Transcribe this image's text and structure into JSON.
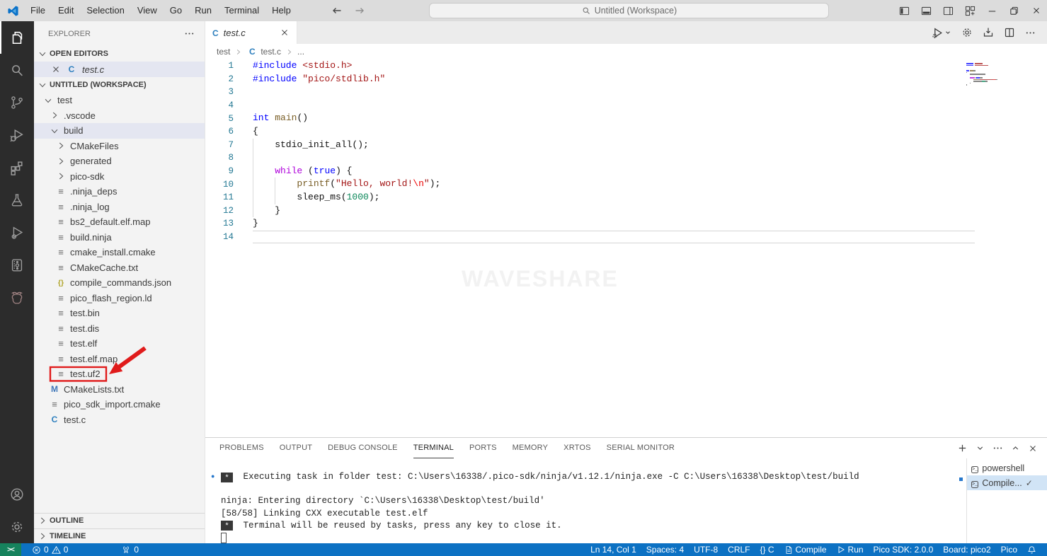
{
  "title_bar": {
    "menus": [
      "File",
      "Edit",
      "Selection",
      "View",
      "Go",
      "Run",
      "Terminal",
      "Help"
    ],
    "search_label": "Untitled (Workspace)",
    "window_controls": [
      {
        "name": "toggle-primary-sidebar-button",
        "icon": "layout-sidebar-left-icon"
      },
      {
        "name": "toggle-panel-button",
        "icon": "layout-panel-icon"
      },
      {
        "name": "toggle-secondary-sidebar-button",
        "icon": "layout-sidebar-right-icon"
      },
      {
        "name": "customize-layout-button",
        "icon": "layout-grid-icon"
      },
      {
        "name": "minimize-button",
        "icon": "minimize-icon"
      },
      {
        "name": "restore-button",
        "icon": "restore-icon"
      },
      {
        "name": "close-button",
        "icon": "close-icon"
      }
    ]
  },
  "activity_bar": {
    "top": [
      {
        "name": "explorer",
        "icon": "files-icon",
        "active": true
      },
      {
        "name": "search",
        "icon": "search-icon"
      },
      {
        "name": "source-control",
        "icon": "source-control-icon"
      },
      {
        "name": "run-and-debug",
        "icon": "run-debug-icon"
      },
      {
        "name": "extensions",
        "icon": "extensions-icon"
      },
      {
        "name": "testing",
        "icon": "testing-icon"
      },
      {
        "name": "cmake",
        "icon": "cmake-icon"
      },
      {
        "name": "pico-board",
        "icon": "board-icon"
      },
      {
        "name": "raspberry-pi-pico",
        "icon": "raspberry-icon",
        "color": "#9d8080"
      }
    ],
    "bottom": [
      {
        "name": "accounts",
        "icon": "account-icon"
      },
      {
        "name": "settings",
        "icon": "settings-gear-icon"
      }
    ]
  },
  "sidebar": {
    "title": "EXPLORER",
    "open_editors_label": "OPEN EDITORS",
    "open_editors": [
      {
        "label": "test.c",
        "icon": "c-file-icon",
        "selected": true
      }
    ],
    "workspace_label": "UNTITLED (WORKSPACE)",
    "tree": [
      {
        "label": "test",
        "level": 1,
        "kind": "folder",
        "expanded": true
      },
      {
        "label": ".vscode",
        "level": 2,
        "kind": "folder",
        "expanded": false
      },
      {
        "label": "build",
        "level": 2,
        "kind": "folder",
        "expanded": true,
        "focused": true
      },
      {
        "label": "CMakeFiles",
        "level": 3,
        "kind": "folder",
        "expanded": false
      },
      {
        "label": "generated",
        "level": 3,
        "kind": "folder",
        "expanded": false
      },
      {
        "label": "pico-sdk",
        "level": 3,
        "kind": "folder",
        "expanded": false
      },
      {
        "label": ".ninja_deps",
        "level": 3,
        "kind": "file",
        "icon": "file-lines-icon"
      },
      {
        "label": ".ninja_log",
        "level": 3,
        "kind": "file",
        "icon": "file-lines-icon"
      },
      {
        "label": "bs2_default.elf.map",
        "level": 3,
        "kind": "file",
        "icon": "file-lines-icon"
      },
      {
        "label": "build.ninja",
        "level": 3,
        "kind": "file",
        "icon": "file-lines-icon"
      },
      {
        "label": "cmake_install.cmake",
        "level": 3,
        "kind": "file",
        "icon": "file-lines-icon"
      },
      {
        "label": "CMakeCache.txt",
        "level": 3,
        "kind": "file",
        "icon": "file-lines-icon"
      },
      {
        "label": "compile_commands.json",
        "level": 3,
        "kind": "file",
        "icon": "json-braces-icon"
      },
      {
        "label": "pico_flash_region.ld",
        "level": 3,
        "kind": "file",
        "icon": "file-lines-icon"
      },
      {
        "label": "test.bin",
        "level": 3,
        "kind": "file",
        "icon": "file-lines-icon"
      },
      {
        "label": "test.dis",
        "level": 3,
        "kind": "file",
        "icon": "file-lines-icon"
      },
      {
        "label": "test.elf",
        "level": 3,
        "kind": "file",
        "icon": "file-lines-icon"
      },
      {
        "label": "test.elf.map",
        "level": 3,
        "kind": "file",
        "icon": "file-lines-icon"
      },
      {
        "label": "test.uf2",
        "level": 3,
        "kind": "file",
        "icon": "file-lines-icon",
        "annotated": true
      },
      {
        "label": "CMakeLists.txt",
        "level": 2,
        "kind": "file",
        "icon": "cmake-m-icon"
      },
      {
        "label": "pico_sdk_import.cmake",
        "level": 2,
        "kind": "file",
        "icon": "file-lines-icon"
      },
      {
        "label": "test.c",
        "level": 2,
        "kind": "file",
        "icon": "c-file-icon"
      }
    ],
    "outline_label": "OUTLINE",
    "timeline_label": "TIMELINE"
  },
  "editor": {
    "tab": {
      "label": "test.c",
      "icon": "c-file-icon"
    },
    "breadcrumb": [
      {
        "label": "test"
      },
      {
        "label": "test.c",
        "icon": "c-file-icon"
      },
      {
        "label": "..."
      }
    ],
    "watermark": "WAVESHARE",
    "code_lines": [
      {
        "n": "1",
        "segs": [
          {
            "t": "#include",
            "c": "kw"
          },
          {
            "t": " "
          },
          {
            "t": "<stdio.h>",
            "c": "str"
          }
        ]
      },
      {
        "n": "2",
        "segs": [
          {
            "t": "#include",
            "c": "kw"
          },
          {
            "t": " "
          },
          {
            "t": "\"pico/stdlib.h\"",
            "c": "str"
          }
        ]
      },
      {
        "n": "3",
        "segs": []
      },
      {
        "n": "4",
        "segs": []
      },
      {
        "n": "5",
        "segs": [
          {
            "t": "int",
            "c": "kw"
          },
          {
            "t": " "
          },
          {
            "t": "main",
            "c": "fn"
          },
          {
            "t": "()"
          }
        ]
      },
      {
        "n": "6",
        "segs": [
          {
            "t": "{"
          }
        ]
      },
      {
        "n": "7",
        "guides": [
          0
        ],
        "segs": [
          {
            "t": "    stdio_init_all();"
          }
        ]
      },
      {
        "n": "8",
        "guides": [
          0
        ],
        "segs": []
      },
      {
        "n": "9",
        "guides": [
          0
        ],
        "segs": [
          {
            "t": "    "
          },
          {
            "t": "while",
            "c": "ctrl"
          },
          {
            "t": " ("
          },
          {
            "t": "true",
            "c": "kw"
          },
          {
            "t": ") {"
          }
        ]
      },
      {
        "n": "10",
        "guides": [
          0,
          4
        ],
        "segs": [
          {
            "t": "        "
          },
          {
            "t": "printf",
            "c": "fn"
          },
          {
            "t": "("
          },
          {
            "t": "\"Hello, world!",
            "c": "str"
          },
          {
            "t": "\\n",
            "c": "esc"
          },
          {
            "t": "\"",
            "c": "str"
          },
          {
            "t": ");"
          }
        ]
      },
      {
        "n": "11",
        "guides": [
          0,
          4
        ],
        "segs": [
          {
            "t": "        sleep_ms("
          },
          {
            "t": "1000",
            "c": "num"
          },
          {
            "t": ");"
          }
        ]
      },
      {
        "n": "12",
        "guides": [
          0
        ],
        "segs": [
          {
            "t": "    }"
          }
        ]
      },
      {
        "n": "13",
        "segs": [
          {
            "t": "}"
          }
        ]
      },
      {
        "n": "14",
        "current": true,
        "segs": []
      }
    ]
  },
  "panel": {
    "tabs": [
      "PROBLEMS",
      "OUTPUT",
      "DEBUG CONSOLE",
      "TERMINAL",
      "PORTS",
      "MEMORY",
      "XRTOS",
      "SERIAL MONITOR"
    ],
    "active_tab": "TERMINAL",
    "actions": [
      {
        "name": "new-terminal-button",
        "icon": "plus-icon"
      },
      {
        "name": "terminal-dropdown-button",
        "icon": "chevron-down-icon"
      },
      {
        "name": "panel-more-actions-button",
        "icon": "ellipsis-icon"
      },
      {
        "name": "maximize-panel-button",
        "icon": "chevron-up-icon"
      },
      {
        "name": "close-panel-button",
        "icon": "close-icon"
      }
    ],
    "terminal_lines": [
      {
        "type": "task",
        "dot": true,
        "badge": "*",
        "text": " Executing task in folder test: C:\\Users\\16338/.pico-sdk/ninja/v1.12.1/ninja.exe -C C:\\Users\\16338\\Desktop\\test/build"
      },
      {
        "type": "blank"
      },
      {
        "type": "plain",
        "text": "ninja: Entering directory `C:\\Users\\16338\\Desktop\\test/build'"
      },
      {
        "type": "plain",
        "text": "[58/58] Linking CXX executable test.elf"
      },
      {
        "type": "task",
        "dot": false,
        "badge": "*",
        "text": " Terminal will be reused by tasks, press any key to close it."
      },
      {
        "type": "cursor"
      }
    ],
    "terminal_list": [
      {
        "label": "powershell",
        "icon": "terminal-icon"
      },
      {
        "label": "Compile...",
        "icon": "terminal-icon",
        "selected": true,
        "check": true
      }
    ]
  },
  "status_bar": {
    "remote_label": "><",
    "problems": {
      "errors": "0",
      "warnings": "0"
    },
    "ports_count": "0",
    "right": [
      {
        "name": "cursor-position",
        "label": "Ln 14, Col 1"
      },
      {
        "name": "indentation",
        "label": "Spaces: 4"
      },
      {
        "name": "encoding",
        "label": "UTF-8"
      },
      {
        "name": "eol",
        "label": "CRLF"
      },
      {
        "name": "language-mode",
        "label": "{} C"
      },
      {
        "name": "compile",
        "label": "Compile",
        "icon": "compile-file-icon"
      },
      {
        "name": "run",
        "label": "Run",
        "icon": "run-outline-icon"
      },
      {
        "name": "pico-sdk-version",
        "label": "Pico SDK: 2.0.0"
      },
      {
        "name": "board",
        "label": "Board: pico2"
      },
      {
        "name": "pico",
        "label": "Pico"
      },
      {
        "name": "notifications",
        "label": "",
        "icon": "bell-icon"
      }
    ]
  },
  "annotations": {
    "target": "test.uf2",
    "color": "#e01b1b"
  }
}
